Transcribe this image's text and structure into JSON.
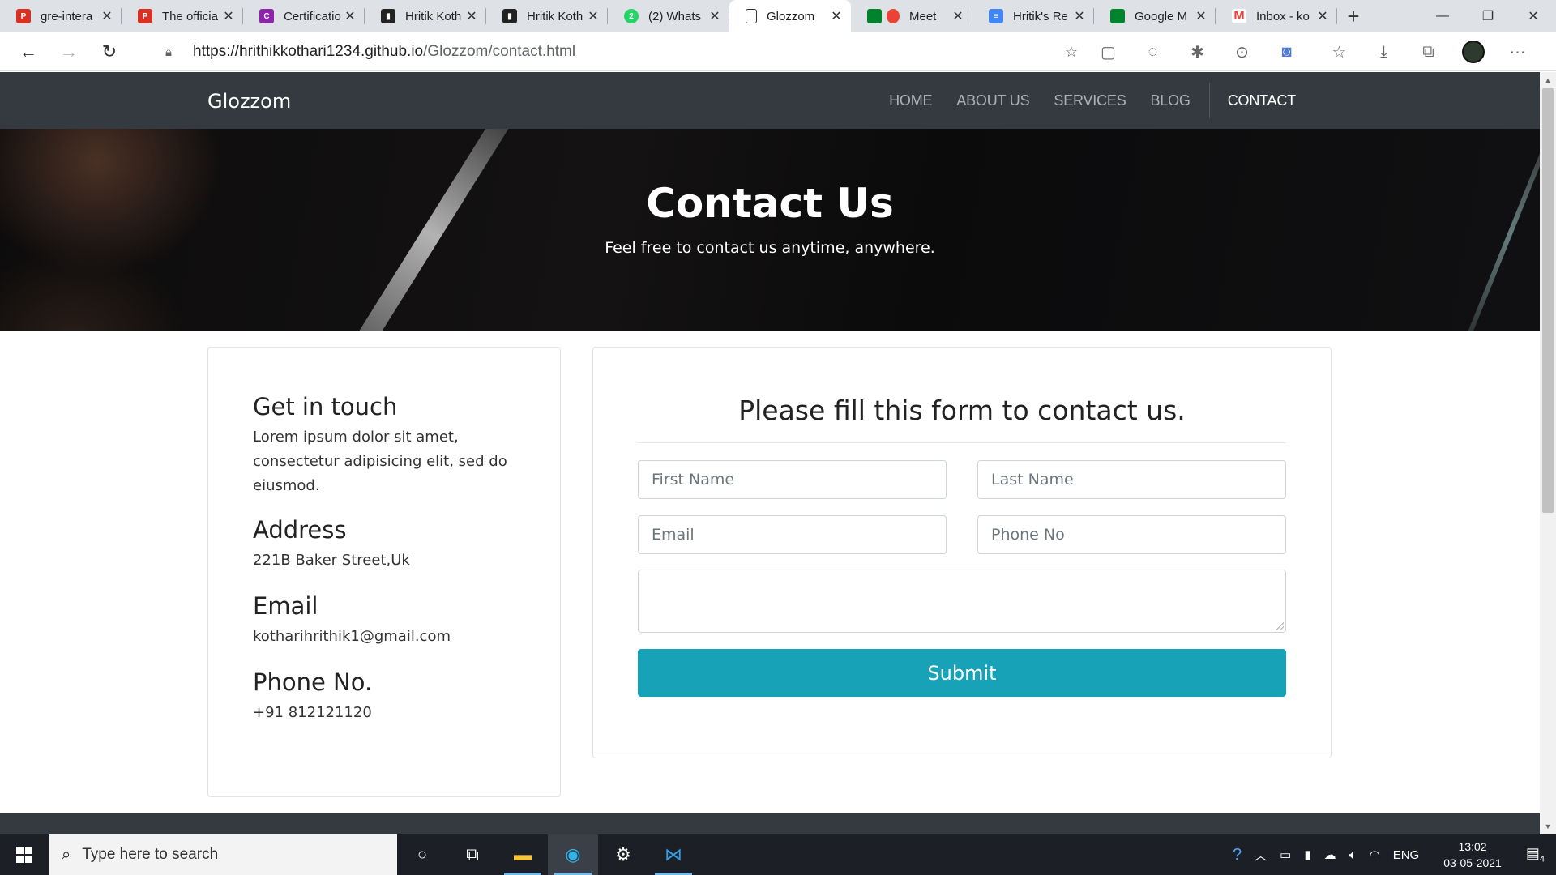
{
  "browser": {
    "tabs": [
      {
        "title": "gre-intera",
        "favicon": "pdf-icon",
        "color": "#d93025"
      },
      {
        "title": "The officia",
        "favicon": "pdf-icon",
        "color": "#d93025"
      },
      {
        "title": "Certificatio",
        "favicon": "certificate-icon",
        "color": "#8e24aa"
      },
      {
        "title": "Hritik Koth",
        "favicon": "profile-icon",
        "color": "#222222"
      },
      {
        "title": "Hritik Koth",
        "favicon": "profile-icon",
        "color": "#222222"
      },
      {
        "title": "(2) Whats",
        "favicon": "whatsapp-icon",
        "color": "#25d366"
      },
      {
        "title": "Glozzom",
        "favicon": "page-icon",
        "color": "#ffffff",
        "active": true
      },
      {
        "title": "Meet",
        "favicon": "meet-icon",
        "color": "#ea4335"
      },
      {
        "title": "Hritik's Re",
        "favicon": "docs-icon",
        "color": "#4285f4"
      },
      {
        "title": "Google M",
        "favicon": "meet-icon",
        "color": "#00832d"
      },
      {
        "title": "Inbox - ko",
        "favicon": "gmail-icon",
        "color": "#ea4335"
      }
    ],
    "new_tab": "+",
    "url_host": "https://hrithikkothari1234.github.io",
    "url_path": "/Glozzom/contact.html"
  },
  "site": {
    "brand": "Glozzom",
    "menu": [
      {
        "label": "HOME"
      },
      {
        "label": "ABOUT US"
      },
      {
        "label": "SERVICES"
      },
      {
        "label": "BLOG"
      },
      {
        "label": "CONTACT",
        "current": true
      }
    ],
    "hero": {
      "title": "Contact Us",
      "subtitle": "Feel free to contact us anytime, anywhere."
    },
    "info": {
      "get_in_touch_heading": "Get in touch",
      "get_in_touch_text": "Lorem ipsum dolor sit amet, consectetur adipisicing elit, sed do eiusmod.",
      "address_heading": "Address",
      "address_text": "221B Baker Street,Uk",
      "email_heading": "Email",
      "email_text": "kotharihrithik1@gmail.com",
      "phone_heading": "Phone No.",
      "phone_text": "+91 812121120"
    },
    "form": {
      "heading": "Please fill this form to contact us.",
      "first_name_placeholder": "First Name",
      "last_name_placeholder": "Last Name",
      "email_placeholder": "Email",
      "phone_placeholder": "Phone No",
      "message_placeholder": "",
      "submit_label": "Submit",
      "submit_color": "#17a2b8"
    }
  },
  "taskbar": {
    "search_placeholder": "Type here to search",
    "language": "ENG",
    "time": "13:02",
    "date": "03-05-2021",
    "notification_count": "4"
  }
}
